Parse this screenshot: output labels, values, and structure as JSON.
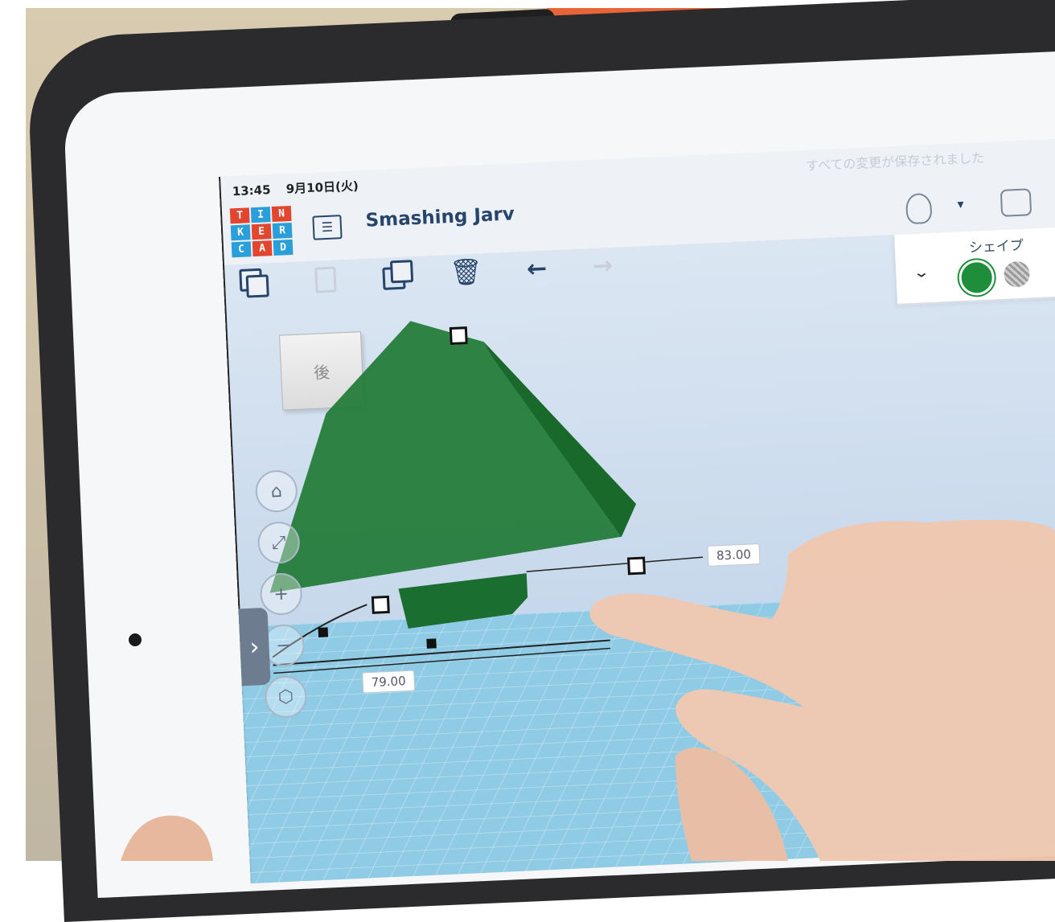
{
  "status_bar": {
    "time": "13:45",
    "date": "9月10日(火)"
  },
  "saved_status": "すべての変更が保存されました",
  "app": {
    "logo_letters": [
      "T",
      "I",
      "N",
      "K",
      "E",
      "R",
      "C",
      "A",
      "D"
    ],
    "logo_colors": [
      "#e2462f",
      "#2b9fd9",
      "#e2462f",
      "#2b9fd9",
      "#e2462f",
      "#2b9fd9",
      "#2b9fd9",
      "#e2462f",
      "#2b9fd9"
    ],
    "design_title": "Smashing Jarv"
  },
  "toolbar": {
    "items": [
      "copy-icon",
      "paste-icon",
      "duplicate-icon",
      "trash-icon",
      "undo-icon",
      "redo-icon"
    ],
    "trash_glyph": "🗑",
    "undo_glyph": "←",
    "redo_glyph": "→"
  },
  "inspector": {
    "label": "シェイプ",
    "collapse_glyph": "⌄",
    "solid_color": "#1f8e3b"
  },
  "viewcube": {
    "face_label": "後"
  },
  "nav": {
    "home_glyph": "⌂",
    "fit_glyph": "⤢",
    "zoom_in_glyph": "+",
    "zoom_out_glyph": "−",
    "ortho_glyph": "⬡",
    "side_tab_glyph": "›"
  },
  "dimensions": {
    "length_label": "79.00",
    "width_label": "83.00"
  },
  "colors": {
    "accent_blue": "#27456b",
    "workplane": "#8ecbe6",
    "shape_green": "#1f7a35"
  }
}
